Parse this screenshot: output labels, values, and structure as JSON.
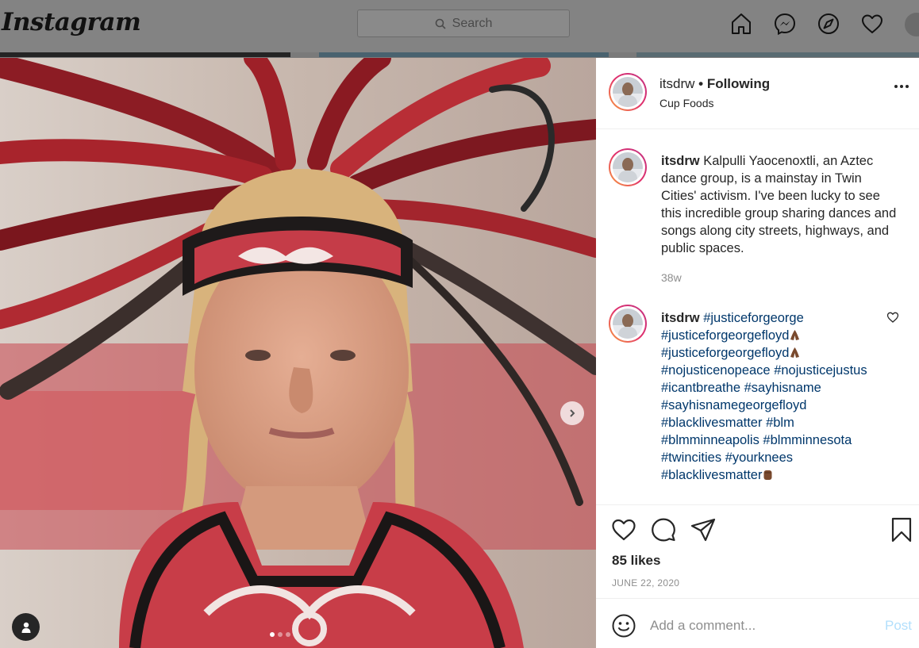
{
  "app": {
    "logo_text": "Instagram",
    "search_placeholder": "Search"
  },
  "nav": {
    "icons": [
      "home-icon",
      "messenger-icon",
      "explore-compass-icon",
      "activity-heart-icon",
      "profile-avatar"
    ]
  },
  "post": {
    "author": "itsdrw",
    "follow_state": "• Following",
    "location": "Cup Foods",
    "caption": "Kalpulli Yaocenoxtli, an Aztec dance group, is a mainstay in Twin Cities' activism. I've been lucky to see this incredible group sharing dances and songs along city streets, highways, and public spaces.",
    "caption_age": "38w",
    "hashtag_comment": {
      "author": "itsdrw",
      "tags": [
        {
          "text": "#justiceforgeorge",
          "emoji": ""
        },
        {
          "text": "#justiceforgeorgefloyd",
          "emoji": "pray-hands-emoji"
        },
        {
          "text": "#justiceforgeorgefloyd",
          "emoji": "pray-hands-emoji"
        },
        {
          "text": "#nojusticenopeace",
          "emoji": ""
        },
        {
          "text": "#nojusticejustus",
          "emoji": ""
        },
        {
          "text": "#icantbreathe",
          "emoji": ""
        },
        {
          "text": "#sayhisname",
          "emoji": ""
        },
        {
          "text": "#sayhisnamegeorgefloyd",
          "emoji": ""
        },
        {
          "text": "#blacklivesmatter",
          "emoji": ""
        },
        {
          "text": "#blm",
          "emoji": ""
        },
        {
          "text": "#blmminneapolis",
          "emoji": ""
        },
        {
          "text": "#blmminnesota",
          "emoji": ""
        },
        {
          "text": "#twincities",
          "emoji": ""
        },
        {
          "text": "#yourknees",
          "emoji": ""
        },
        {
          "text": "#blacklivesmatter",
          "emoji": "raised-fist-emoji"
        }
      ]
    },
    "likes": "85 likes",
    "date": "JUNE 22, 2020",
    "comment_placeholder": "Add a comment...",
    "post_button": "Post",
    "carousel": {
      "slides": 3,
      "current": 1
    }
  },
  "colors": {
    "hashtag": "#00376b",
    "post_disabled": "#b2dffc",
    "muted": "#8e8e8e",
    "story_ring": [
      "#f9a13d",
      "#e1306c",
      "#c13584"
    ]
  }
}
